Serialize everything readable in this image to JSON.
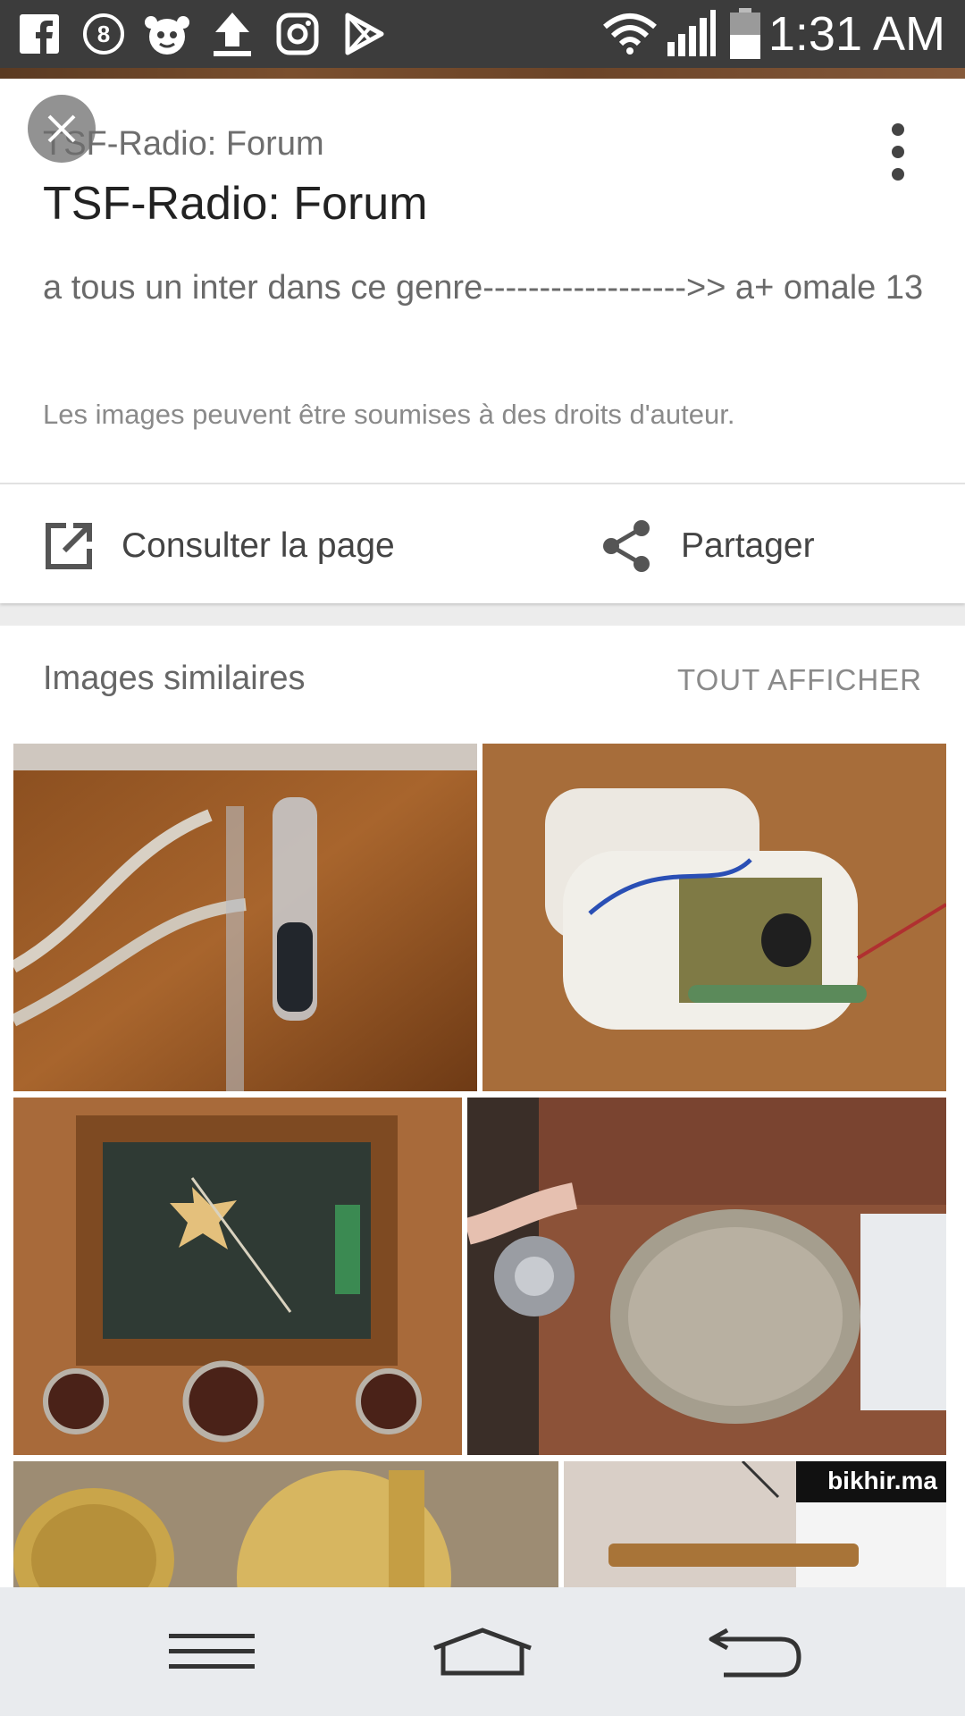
{
  "status_bar": {
    "time": "1:31 AM",
    "left_icons": [
      "facebook-icon",
      "app-8-icon",
      "emoji-app-icon",
      "upload-icon",
      "instagram-icon",
      "play-store-icon"
    ],
    "right_icons": [
      "wifi-icon",
      "signal-icon",
      "battery-icon"
    ]
  },
  "card": {
    "source_small": "TSF-Radio: Forum",
    "title": "TSF-Radio: Forum",
    "snippet": "a tous un inter dans ce genre------------------>> a+ omale 13",
    "copyright": "Les images peuvent être soumises à des droits d'auteur.",
    "actions": {
      "open_label": "Consulter la page",
      "share_label": "Partager"
    }
  },
  "similar": {
    "title": "Images similaires",
    "show_all": "TOUT AFFICHER",
    "watermark": "bikhir.ma"
  },
  "nav": {
    "buttons": [
      "menu-button",
      "home-button",
      "back-button"
    ]
  },
  "colors": {
    "status_bar": "#3c3c3c",
    "card_bg": "#ffffff",
    "nav_bg": "#e9ebee",
    "text_primary": "#222222",
    "text_secondary": "#6a6a6a"
  }
}
